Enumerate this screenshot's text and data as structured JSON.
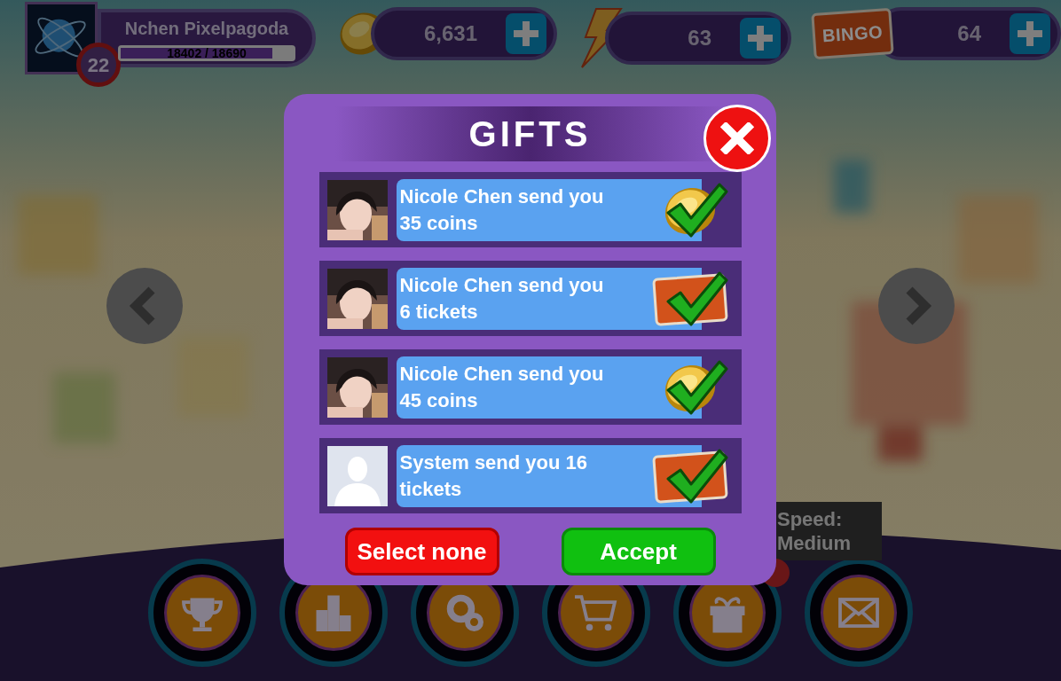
{
  "player": {
    "name": "Nchen Pixelpagoda",
    "xp": "18402 / 18690",
    "level": 0.88,
    "rank": "22"
  },
  "counters": [
    {
      "kind": "coins",
      "value": "6,631"
    },
    {
      "kind": "energy",
      "value": "63"
    },
    {
      "kind": "tickets",
      "value": "64",
      "icon_label": "BINGO"
    }
  ],
  "speed": {
    "label": "Speed:",
    "value": "Medium"
  },
  "nav": [
    {
      "kind": "trophy"
    },
    {
      "kind": "podium"
    },
    {
      "kind": "settings"
    },
    {
      "kind": "cart"
    },
    {
      "kind": "gift"
    },
    {
      "kind": "mail"
    }
  ],
  "dialog": {
    "title": "GIFTS",
    "gifts": [
      {
        "message": "Nicole Chen send you 35 coins",
        "reward": {
          "kind": "coins"
        },
        "checked": true
      },
      {
        "message": "Nicole Chen send you 6 tickets",
        "reward": {
          "kind": "tickets"
        },
        "checked": true
      },
      {
        "message": "Nicole Chen send you 45 coins",
        "reward": {
          "kind": "coins"
        },
        "checked": true
      },
      {
        "avatar": {
          "kind": "silhouette"
        },
        "message": "System send you 16 tickets",
        "reward": {
          "kind": "tickets"
        },
        "checked": true
      }
    ],
    "buttons": [
      {
        "kind": "cancel",
        "label": "Select none"
      },
      {
        "kind": "confirm",
        "label": "Accept"
      }
    ]
  }
}
